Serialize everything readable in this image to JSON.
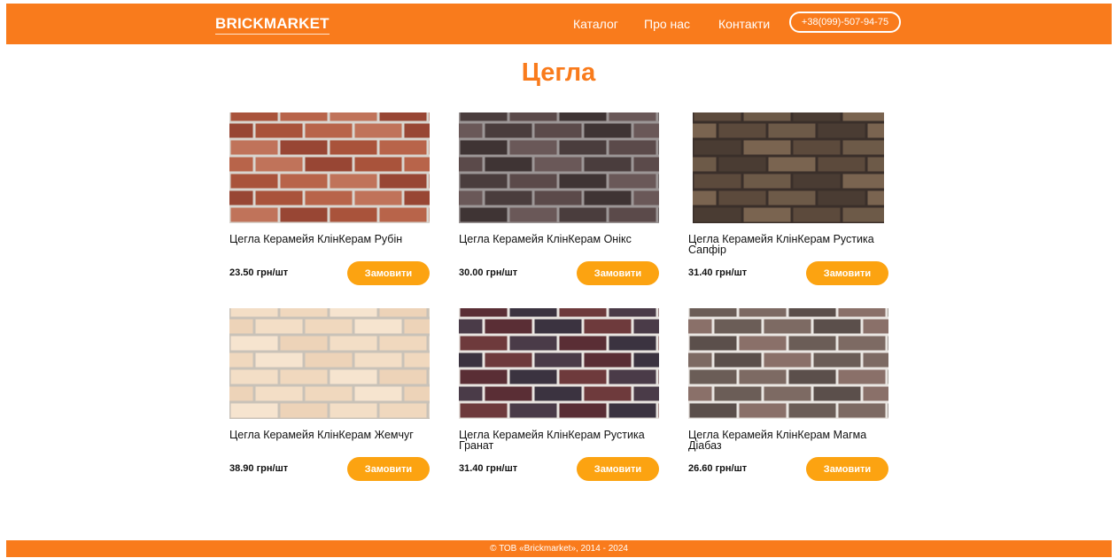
{
  "header": {
    "logo": "BRICKMARKET",
    "nav": {
      "catalog": "Каталог",
      "about": "Про нас",
      "contacts": "Контакти"
    },
    "phone": "+38(099)-507-94-75"
  },
  "page_title": "Цегла",
  "products": [
    {
      "name": "Цегла Керамейя КлінКерам Рубін",
      "price": "23.50 грн/шт",
      "button": "Замовити",
      "brick_colors": [
        "#a9533b",
        "#b8644a",
        "#c0735a",
        "#984634"
      ],
      "mortar_color": "#d9d5cf"
    },
    {
      "name": "Цегла Керамейя КлінКерам Онікс",
      "price": "30.00 грн/шт",
      "button": "Замовити",
      "brick_colors": [
        "#4a3d3d",
        "#5b4a4a",
        "#3f3434",
        "#6a5858"
      ],
      "mortar_color": "#9c9696"
    },
    {
      "name": "Цегла Керамейя КлінКерам Рустика Сапфір",
      "price": "31.40 грн/шт",
      "button": "Замовити",
      "brick_colors": [
        "#5c4a3c",
        "#6d5a48",
        "#4a3c33",
        "#7a6450"
      ],
      "mortar_color": "#3a2f2a"
    },
    {
      "name": "Цегла Керамейя КлінКерам Жемчуг",
      "price": "38.90 грн/шт",
      "button": "Замовити",
      "brick_colors": [
        "#f3dec6",
        "#f0d8be",
        "#f6e4cf",
        "#edd3b8"
      ],
      "mortar_color": "#c9c2b8"
    },
    {
      "name": "Цегла Керамейя КлінКерам Рустика Гранат",
      "price": "31.40 грн/шт",
      "button": "Замовити",
      "brick_colors": [
        "#5a2e35",
        "#3b3340",
        "#6e3a3c",
        "#4a3b48"
      ],
      "mortar_color": "#e8e4e0"
    },
    {
      "name": "Цегла Керамейя КлінКерам Магма Діабаз",
      "price": "26.60 грн/шт",
      "button": "Замовити",
      "brick_colors": [
        "#6b5d57",
        "#7d6a63",
        "#5b4f4b",
        "#8a7069"
      ],
      "mortar_color": "#eae6e2"
    }
  ],
  "footer": {
    "copyright": "© ТОВ «Brickmarket», 2014 - 2024"
  }
}
